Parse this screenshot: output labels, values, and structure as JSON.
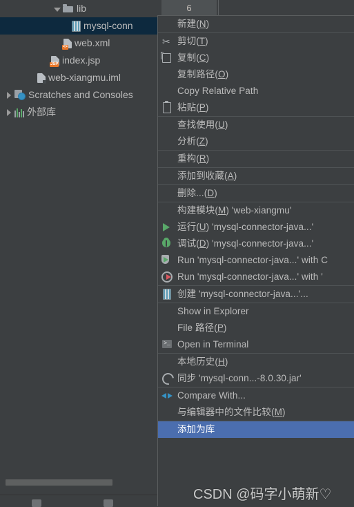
{
  "tabbar": {
    "tab_label": "6"
  },
  "tree": {
    "items": [
      {
        "label": "lib",
        "indent": 78,
        "arrow": "down",
        "icon": "folder-icon",
        "selected": false
      },
      {
        "label": "mysql-conn",
        "indent": 104,
        "arrow": "none",
        "icon": "jar-file-icon",
        "selected": true
      },
      {
        "label": "web.xml",
        "indent": 92,
        "arrow": "none",
        "icon": "xml-file-icon",
        "selected": false
      },
      {
        "label": "index.jsp",
        "indent": 74,
        "arrow": "none",
        "icon": "jsp-file-icon",
        "selected": false
      },
      {
        "label": "web-xiangmu.iml",
        "indent": 54,
        "arrow": "none",
        "icon": "iml-file-icon",
        "selected": false
      },
      {
        "label": "Scratches and Consoles",
        "indent": 8,
        "arrow": "right",
        "icon": "scratches-icon",
        "selected": false
      },
      {
        "label": "外部库",
        "indent": 8,
        "arrow": "right",
        "icon": "library-icon",
        "selected": false
      }
    ]
  },
  "context_menu": {
    "items": [
      {
        "label": "新建(N)",
        "icon": "none",
        "sep_top": false,
        "highlight": false
      },
      {
        "label": "剪切(T)",
        "icon": "scissors-icon",
        "sep_top": true,
        "highlight": false
      },
      {
        "label": "复制(C)",
        "icon": "copy-icon",
        "sep_top": false,
        "highlight": false
      },
      {
        "label": "复制路径(O)",
        "icon": "none",
        "sep_top": false,
        "highlight": false
      },
      {
        "label": "Copy Relative Path",
        "icon": "none",
        "sep_top": false,
        "highlight": false
      },
      {
        "label": "粘贴(P)",
        "icon": "paste-icon",
        "sep_top": false,
        "highlight": false
      },
      {
        "label": "查找使用(U)",
        "icon": "none",
        "sep_top": true,
        "highlight": false
      },
      {
        "label": "分析(Z)",
        "icon": "none",
        "sep_top": false,
        "highlight": false
      },
      {
        "label": "重构(R)",
        "icon": "none",
        "sep_top": true,
        "highlight": false
      },
      {
        "label": "添加到收藏(A)",
        "icon": "none",
        "sep_top": true,
        "highlight": false
      },
      {
        "label": "删除...(D)",
        "icon": "none",
        "sep_top": true,
        "highlight": false
      },
      {
        "label": "构建模块(M) 'web-xiangmu'",
        "icon": "none",
        "sep_top": true,
        "highlight": false
      },
      {
        "label": "运行(U) 'mysql-connector-java...'",
        "icon": "run-icon",
        "sep_top": false,
        "highlight": false
      },
      {
        "label": "调试(D) 'mysql-connector-java...'",
        "icon": "debug-icon",
        "sep_top": false,
        "highlight": false
      },
      {
        "label": "Run 'mysql-connector-java...' with C",
        "icon": "coverage-icon",
        "sep_top": false,
        "highlight": false
      },
      {
        "label": "Run 'mysql-connector-java...' with '",
        "icon": "profiler-icon",
        "sep_top": false,
        "highlight": false
      },
      {
        "label": "创建 'mysql-connector-java...'...",
        "icon": "jar-file-icon",
        "sep_top": true,
        "highlight": false
      },
      {
        "label": "Show in Explorer",
        "icon": "none",
        "sep_top": true,
        "highlight": false
      },
      {
        "label": "File 路径(P)",
        "icon": "none",
        "sep_top": false,
        "highlight": false
      },
      {
        "label": "Open in Terminal",
        "icon": "terminal-icon",
        "sep_top": false,
        "highlight": false
      },
      {
        "label": "本地历史(H)",
        "icon": "none",
        "sep_top": true,
        "highlight": false
      },
      {
        "label": "同步 'mysql-conn...-8.0.30.jar'",
        "icon": "sync-icon",
        "sep_top": false,
        "highlight": false
      },
      {
        "label": "Compare With...",
        "icon": "compare-icon",
        "sep_top": true,
        "highlight": false
      },
      {
        "label": "与编辑器中的文件比较(M)",
        "icon": "none",
        "sep_top": false,
        "highlight": false
      },
      {
        "label": "添加为库",
        "icon": "none",
        "sep_top": true,
        "highlight": true
      }
    ]
  },
  "watermark": {
    "text": "CSDN @码字小萌新♡"
  },
  "colors": {
    "menu_bg": "#3c3f41",
    "menu_text": "#bbbbbb",
    "highlight_bg": "#4b6eaf",
    "tree_selected_bg": "#0d293e",
    "separator": "#4f5355",
    "accent_green": "#59a869",
    "accent_blue": "#3592c4",
    "accent_red": "#db5860"
  }
}
